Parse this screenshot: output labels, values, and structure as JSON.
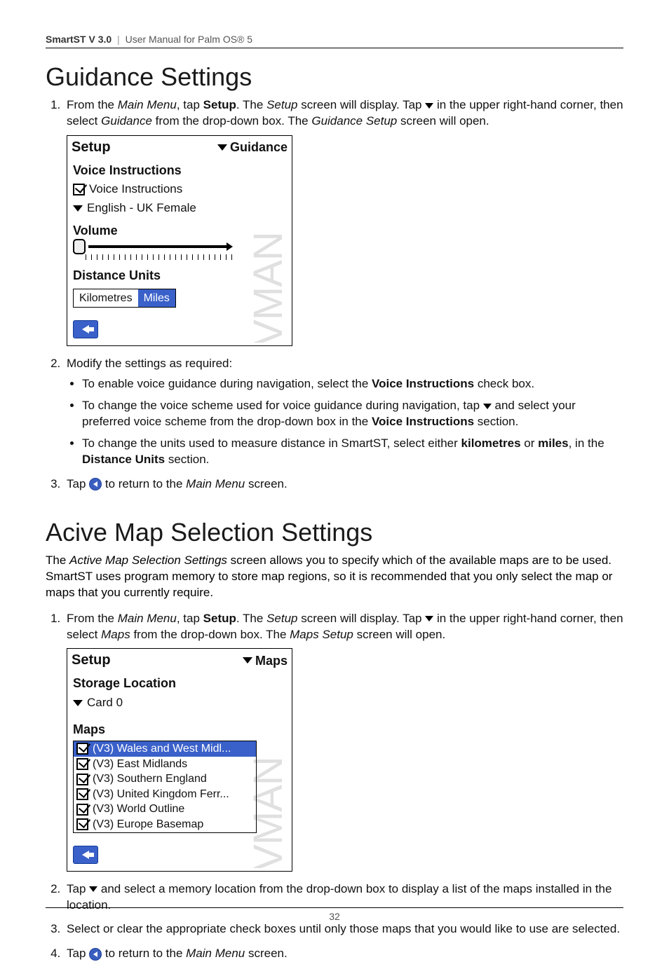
{
  "header": {
    "brand_bold": "SmartST V 3.0",
    "sep": "|",
    "rest": "User Manual for Palm OS® 5"
  },
  "page_number": "32",
  "section_guidance": {
    "title": "Guidance Settings",
    "step1": {
      "pre": "From the ",
      "ital1": "Main Menu",
      "mid1": ", tap ",
      "bold1": "Setup",
      "mid2": ". The ",
      "ital2": "Setup",
      "mid3": " screen will display. Tap ",
      "mid4": " in the upper right-hand corner, then select ",
      "ital3": "Guidance",
      "mid5": " from the drop-down box. The ",
      "ital4": "Guidance Setup",
      "mid6": " screen will open."
    },
    "step2_lead": "Modify the settings as required:",
    "bullets": {
      "b1": {
        "text": "To enable voice guidance during navigation, select the ",
        "bold": "Voice Instructions",
        "tail": " check box."
      },
      "b2": {
        "t1": "To change the voice scheme used for voice guidance during navigation, tap ",
        "t2": " and select your preferred voice scheme from the drop-down box in the ",
        "bold": "Voice Instructions",
        "t3": " section."
      },
      "b3": {
        "t1": "To change the units used to measure distance in SmartST, select either ",
        "b1": "kilometres",
        "t2": " or ",
        "b2": "miles",
        "t3": ", in the ",
        "b3": "Distance Units",
        "t4": " section."
      }
    },
    "step3": {
      "t1": "Tap ",
      "t2": " to return to the ",
      "ital": "Main Menu",
      "t3": " screen."
    },
    "shot": {
      "title": "Setup",
      "menu": "Guidance",
      "sec_voice": "Voice Instructions",
      "voice_label": "Voice Instructions",
      "voice_option": "English - UK Female",
      "sec_volume": "Volume",
      "sec_units": "Distance Units",
      "unit_km": "Kilometres",
      "unit_mi": "Miles",
      "watermark": "NAVMAN"
    }
  },
  "section_maps": {
    "title": "Acive Map Selection Settings",
    "intro": {
      "t1": "The ",
      "ital": "Active Map Selection Settings",
      "t2": " screen allows you to specify which of the available maps are to be used. SmartST uses program memory to store map regions, so it is recommended that you only select the map or maps that you currently require."
    },
    "step1": {
      "pre": "From the ",
      "ital1": "Main Menu",
      "mid1": ", tap ",
      "bold1": "Setup",
      "mid2": ". The ",
      "ital2": "Setup",
      "mid3": " screen will display. Tap ",
      "mid4": " in the upper right-hand corner, then select ",
      "ital3": "Maps",
      "mid5": " from the drop-down box. The ",
      "ital4": "Maps Setup",
      "mid6": " screen will open."
    },
    "step2": {
      "t1": "Tap ",
      "t2": " and select a memory location from the drop-down box to display a list of the maps installed in the location."
    },
    "step3": "Select or clear the appropriate check boxes until only those maps that you would like to use are selected.",
    "step4": {
      "t1": "Tap ",
      "t2": " to return to the ",
      "ital": "Main Menu",
      "t3": " screen."
    },
    "shot": {
      "title": "Setup",
      "menu": "Maps",
      "sec_storage": "Storage Location",
      "storage_value": "Card 0",
      "sec_maps": "Maps",
      "items": [
        "(V3) Wales and West Midl...",
        "(V3) East Midlands",
        "(V3) Southern England",
        "(V3) United Kingdom Ferr...",
        "(V3) World Outline",
        "(V3) Europe Basemap"
      ],
      "watermark": "NAVMAN"
    }
  }
}
